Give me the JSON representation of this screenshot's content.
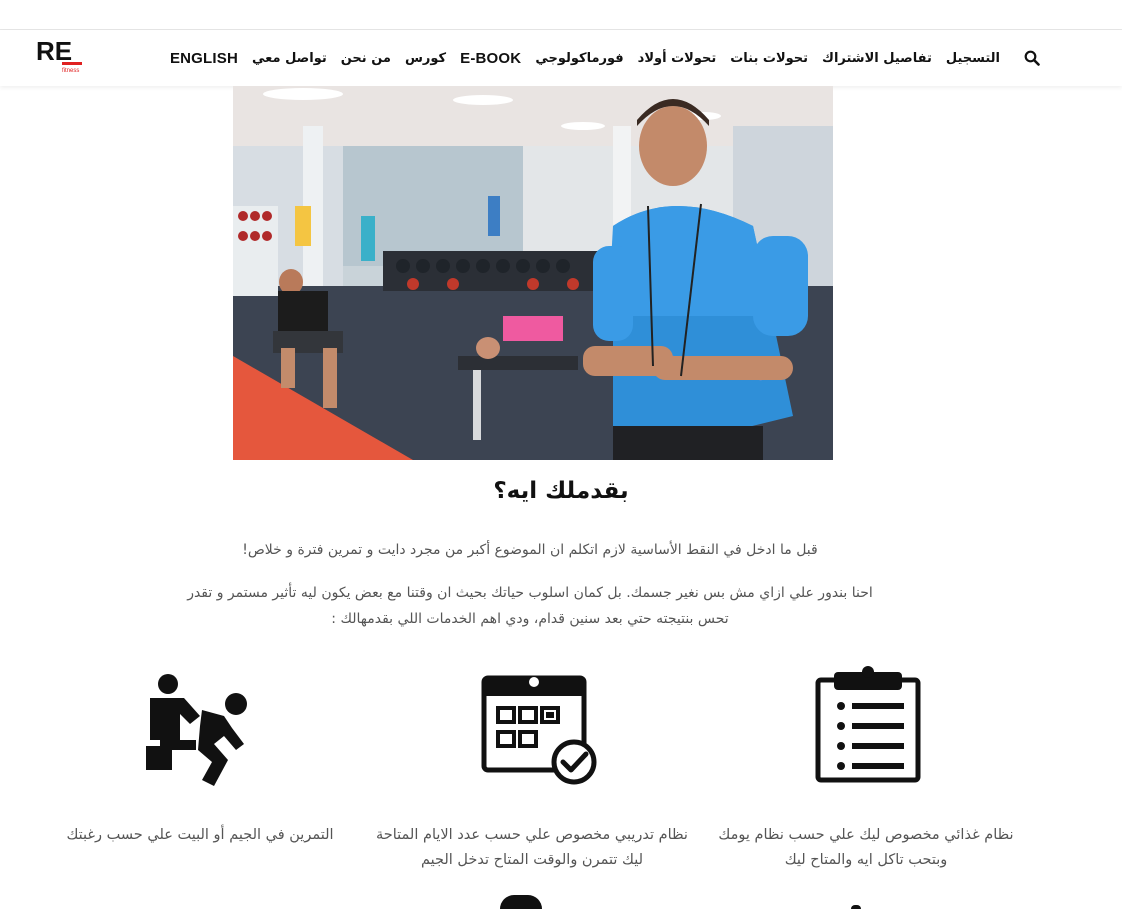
{
  "header": {
    "logo_text": "RE",
    "logo_subtext": "fitness",
    "nav_items": [
      {
        "label": "التسجيل"
      },
      {
        "label": "تفاصيل الاشتراك"
      },
      {
        "label": "تحولات بنات"
      },
      {
        "label": "تحولات أولاد"
      },
      {
        "label": "فورماكولوجي"
      },
      {
        "label": "E-BOOK"
      },
      {
        "label": "كورس"
      },
      {
        "label": "من نحن"
      },
      {
        "label": "تواصل معي"
      },
      {
        "label": "ENGLISH"
      }
    ],
    "search_icon": "search-icon"
  },
  "main": {
    "heading": "بقدملك ايه؟",
    "paragraph1": "قبل ما ادخل في النقط الأساسية لازم اتكلم ان الموضوع أكبر من مجرد دايت و تمرين فترة و خلاص!",
    "paragraph2": "احنا بندور علي ازاي مش بس نغير جسمك. بل كمان اسلوب حياتك بحيث ان وقتنا مع بعض يكون ليه تأثير مستمر و تقدر تحس بنتيجته حتي بعد سنين قدام، ودي اهم الخدمات اللي بقدمهالك :",
    "features": [
      {
        "icon": "clipboard-list-icon",
        "text": "نظام غذائي مخصوص ليك علي حسب نظام يومك وبتحب تاكل ايه والمتاح ليك"
      },
      {
        "icon": "calendar-check-icon",
        "text": "نظام تدريبي مخصوص علي حسب عدد الايام المتاحة ليك تتمرن والوقت المتاح تدخل الجيم"
      },
      {
        "icon": "trainer-exercise-icon",
        "text": "التمرين في الجيم أو البيت علي حسب رغبتك"
      }
    ]
  },
  "colors": {
    "text_dark": "#111111",
    "text_muted": "#555555",
    "accent_red": "#e02020"
  }
}
